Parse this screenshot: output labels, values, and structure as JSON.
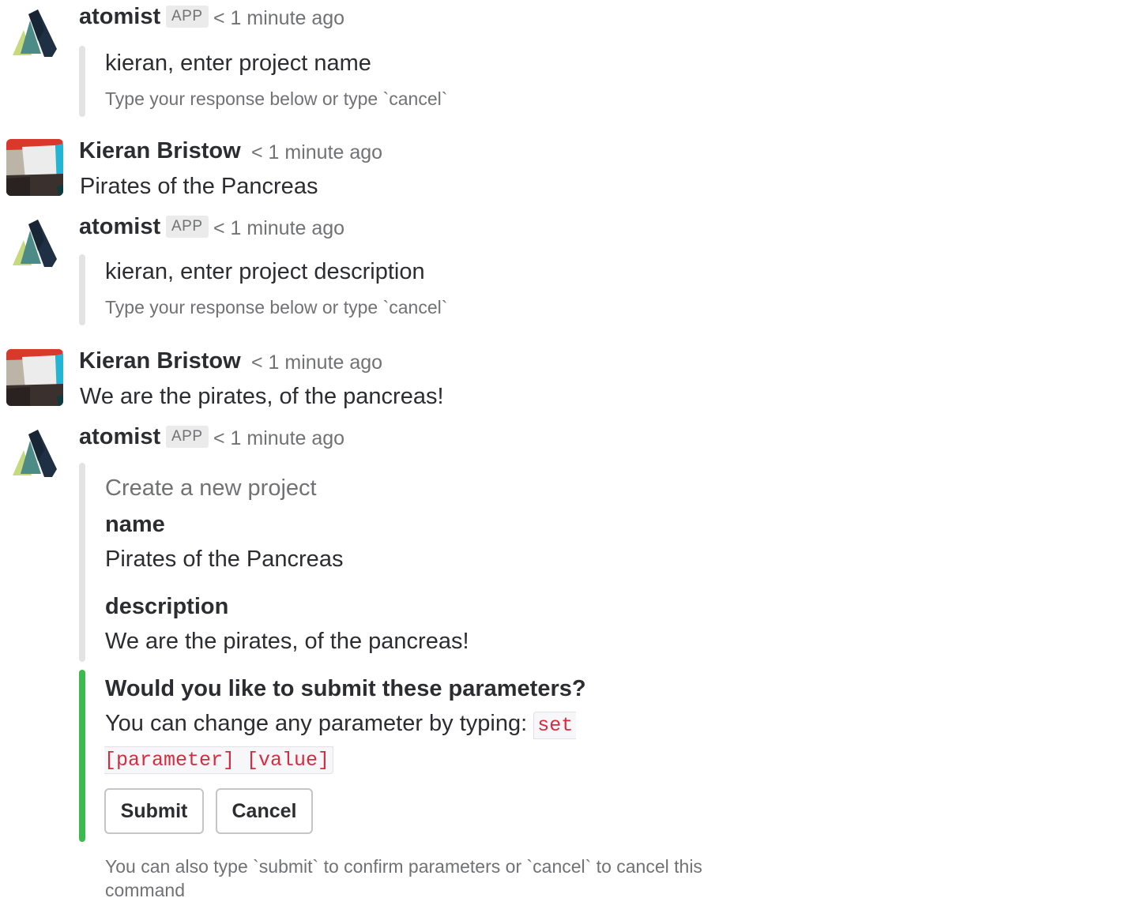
{
  "colors": {
    "attachment_bar": "#e3e3e3",
    "confirm_bar": "#3dba4e",
    "code_text": "#d72b3f",
    "muted_text": "#717274"
  },
  "messages": [
    {
      "sender": "atomist",
      "badge": "APP",
      "time": "< 1 minute ago",
      "avatar_icon": "atomist-logo-icon",
      "attachment": {
        "title": "kieran, enter project name",
        "subtitle": "Type your response below or type `cancel`"
      }
    },
    {
      "sender": "Kieran Bristow",
      "time": "< 1 minute ago",
      "avatar_icon": "user-avatar-icon",
      "text": "Pirates of the Pancreas"
    },
    {
      "sender": "atomist",
      "badge": "APP",
      "time": "< 1 minute ago",
      "avatar_icon": "atomist-logo-icon",
      "attachment": {
        "title": "kieran, enter project description",
        "subtitle": "Type your response below or type `cancel`"
      }
    },
    {
      "sender": "Kieran Bristow",
      "time": "< 1 minute ago",
      "avatar_icon": "user-avatar-icon",
      "text": "We are the pirates, of the pancreas!"
    },
    {
      "sender": "atomist",
      "badge": "APP",
      "time": "< 1 minute ago",
      "avatar_icon": "atomist-logo-icon",
      "summary": {
        "pretext": "Create a new project",
        "fields": [
          {
            "label": "name",
            "value": "Pirates of the Pancreas"
          },
          {
            "label": "description",
            "value": "We are the pirates, of the pancreas!"
          }
        ]
      },
      "confirm": {
        "title": "Would you like to submit these parameters?",
        "body_prefix": "You can change any parameter by typing: ",
        "code_line1": "set",
        "code_line2": "[parameter] [value]",
        "buttons": [
          "Submit",
          "Cancel"
        ]
      },
      "footer": "You can also type `submit` to confirm parameters or `cancel` to cancel this command"
    }
  ]
}
